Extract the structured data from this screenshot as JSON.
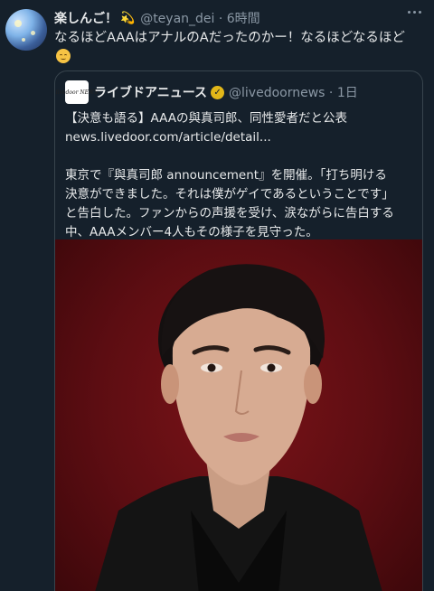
{
  "tweet": {
    "display_name": "楽しんご！",
    "name_emoji": "💫",
    "handle_time": "@teyan_dei · 6時間",
    "text": "なるほどAAAはアナルのAだったのかー！なるほどなるほど",
    "emoji_icon": "relieved-face-icon"
  },
  "quote": {
    "logo_text": "livedoor NEWS",
    "name": "ライブドアニュース",
    "verified_icon": "gold-verified-badge-icon",
    "handle_time": "@livedoornews · 1日",
    "lines": [
      "【決意も語る】AAAの與真司郎、同性愛者だと公表",
      "news.livedoor.com/article/detail...",
      "東京で『與真司郎 announcement』を開催。「打ち明ける",
      "決意ができました。それは僕がゲイであるということです」",
      "と告白した。ファンからの声援を受け、涙ながらに告白する",
      "中、AAAメンバー4人もその様子を見守った。"
    ]
  },
  "colors": {
    "background": "#15202b",
    "text": "#e7e9ea",
    "secondary": "#8b98a5",
    "border": "#38444d",
    "photo_bg": "#6a0f15"
  }
}
